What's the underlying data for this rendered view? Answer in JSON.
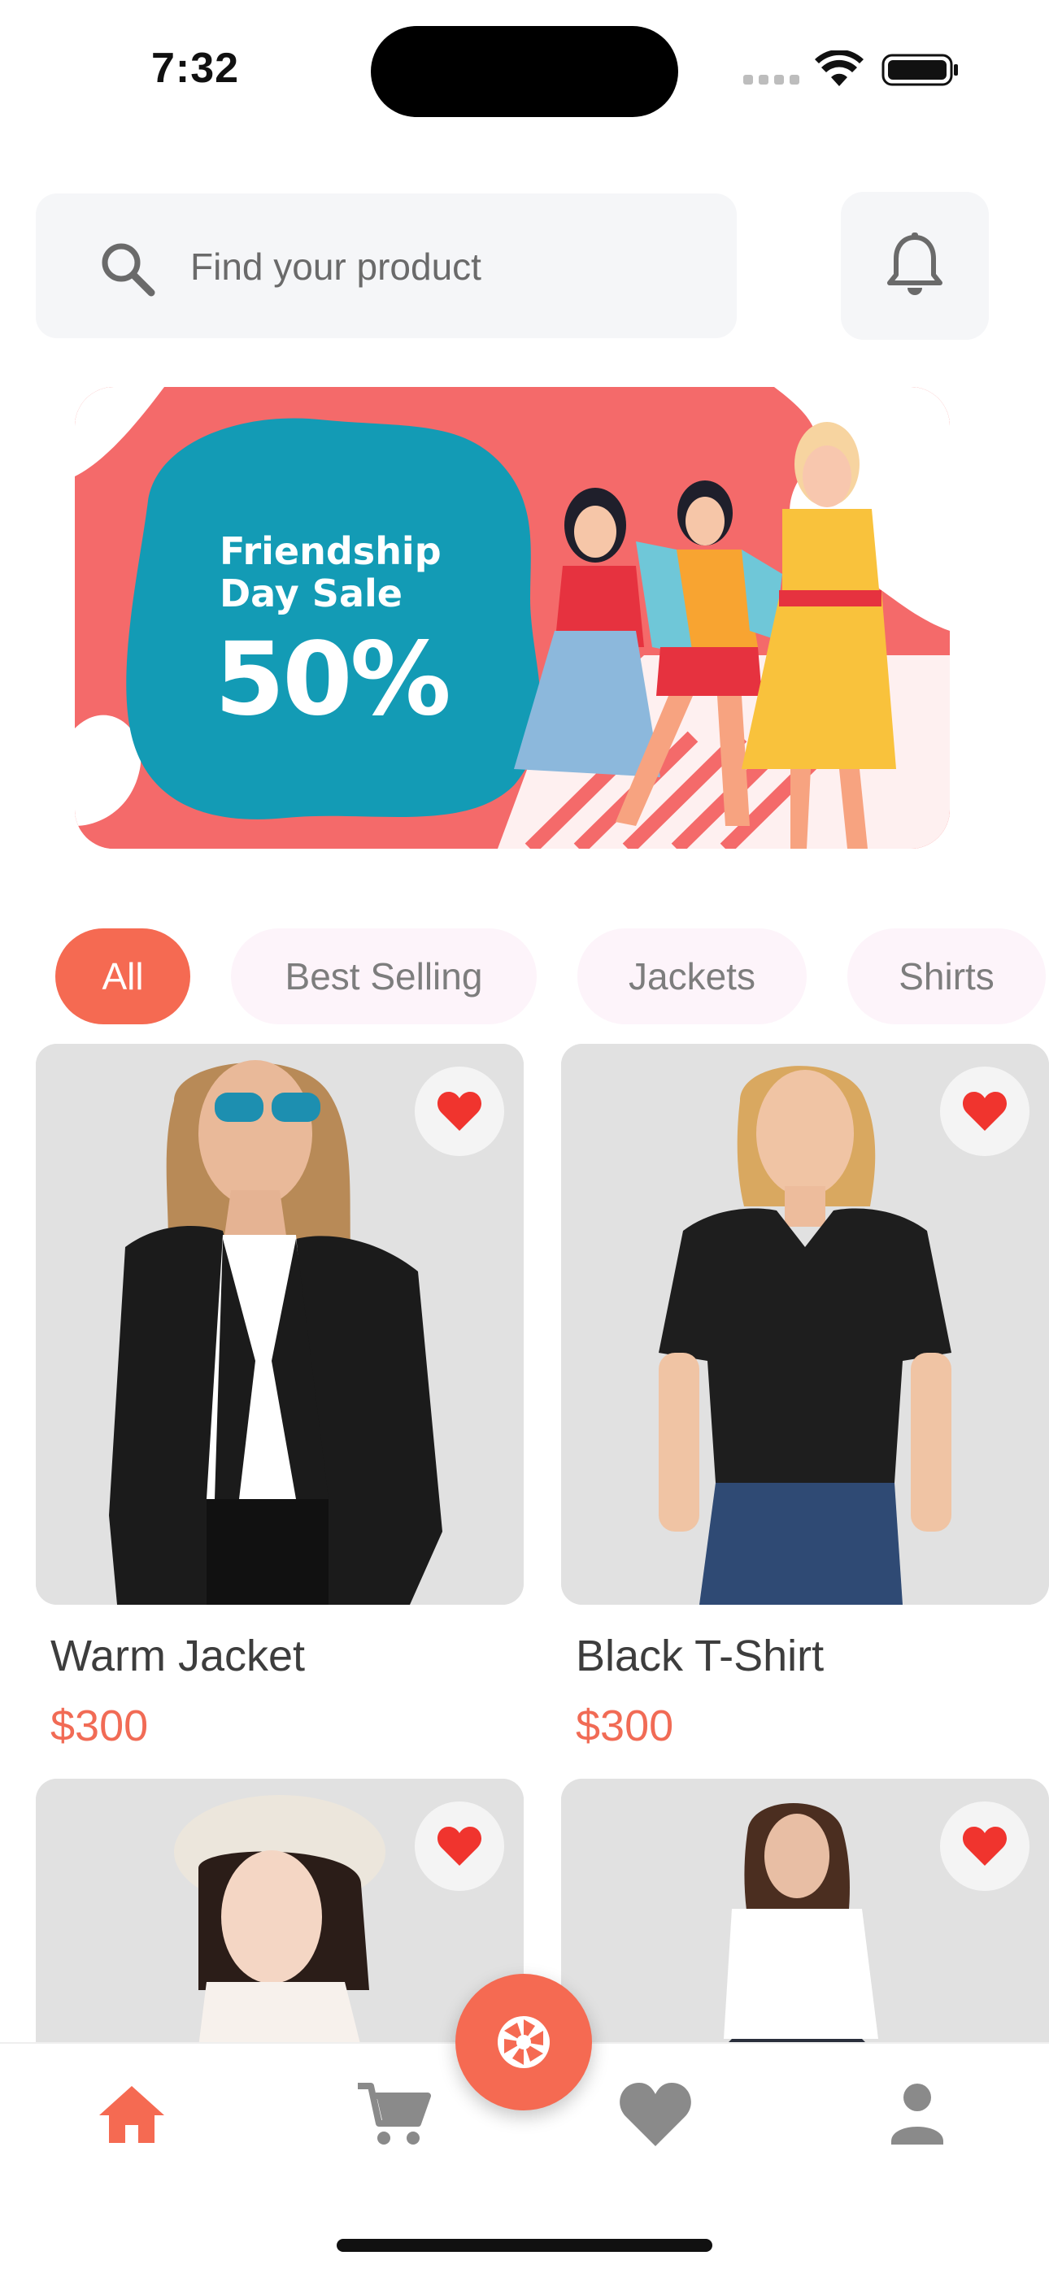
{
  "status_bar": {
    "time": "7:32"
  },
  "search": {
    "placeholder": "Find your product"
  },
  "banner": {
    "title": "Friendship Day Sale",
    "discount": "50%"
  },
  "categories": [
    {
      "label": "All",
      "active": true
    },
    {
      "label": "Best Selling",
      "active": false
    },
    {
      "label": "Jackets",
      "active": false
    },
    {
      "label": "Shirts",
      "active": false
    }
  ],
  "products": [
    {
      "name": "Warm Jacket",
      "price": "$300",
      "favorite": true
    },
    {
      "name": "Black T-Shirt",
      "price": "$300",
      "favorite": true
    },
    {
      "name": "",
      "price": "",
      "favorite": true
    },
    {
      "name": "",
      "price": "",
      "favorite": true
    }
  ],
  "nav": {
    "items": [
      {
        "icon": "home-icon",
        "active": true
      },
      {
        "icon": "cart-icon",
        "active": false
      },
      {
        "icon": "heart-icon",
        "active": false
      },
      {
        "icon": "profile-icon",
        "active": false
      }
    ],
    "fab_icon": "camera-aperture-icon"
  },
  "colors": {
    "accent": "#f56a52",
    "price": "#f16b55",
    "heart": "#f0342e",
    "banner_teal": "#139bb5",
    "banner_coral": "#f46a6a"
  }
}
